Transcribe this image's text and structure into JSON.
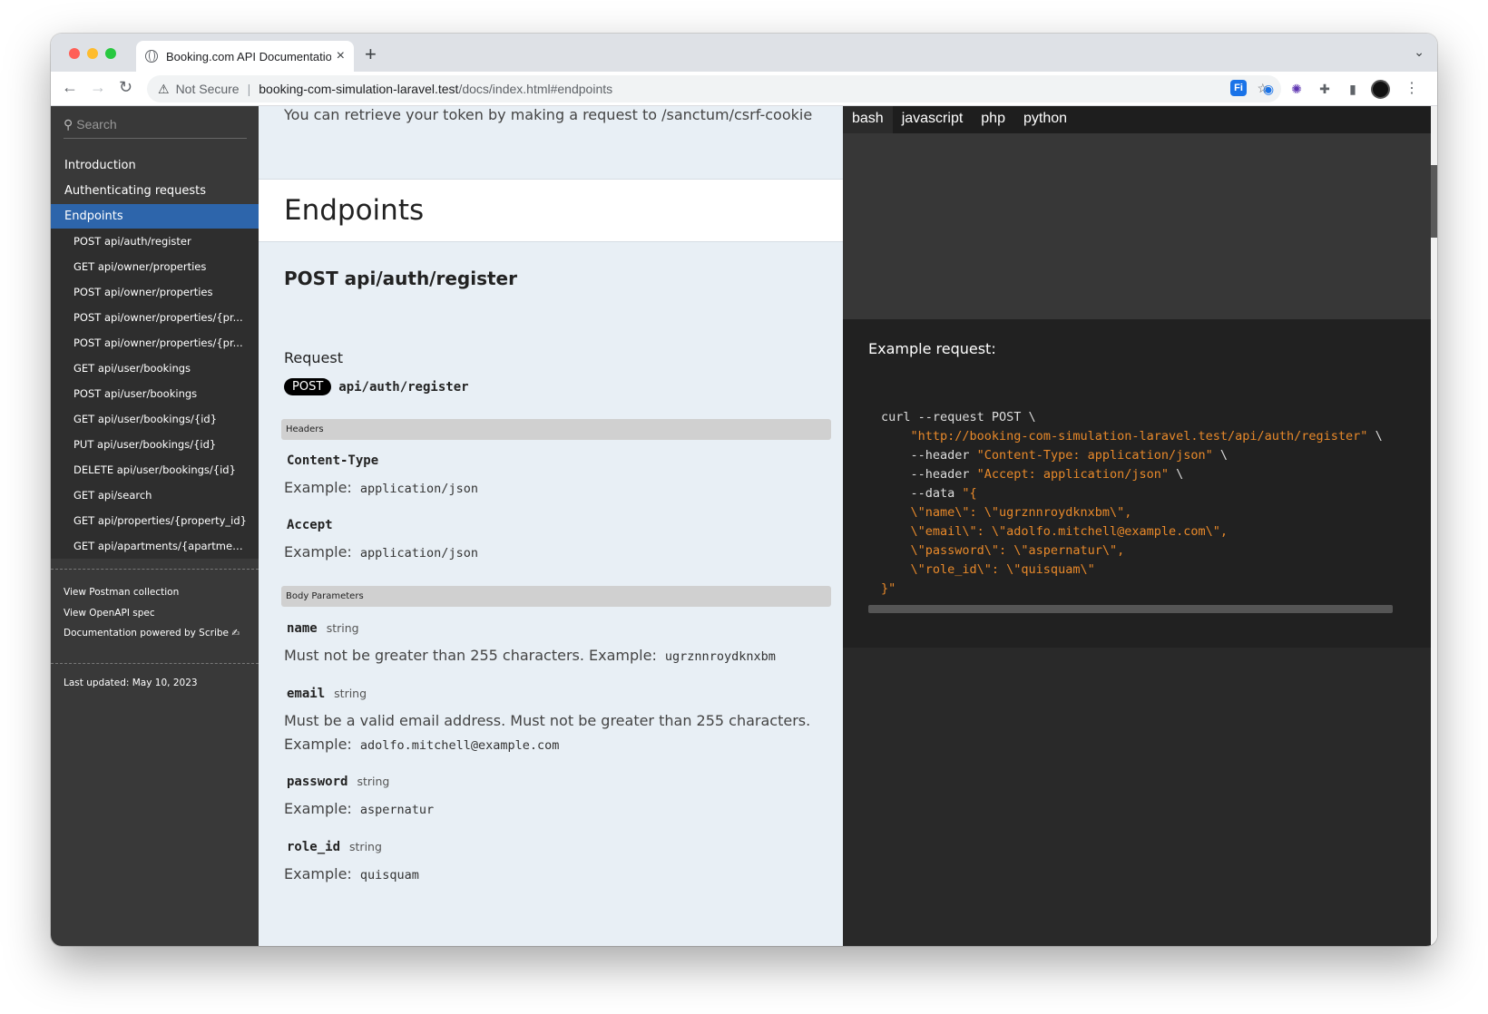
{
  "browser": {
    "tab_title": "Booking.com API Documentatio",
    "not_secure": "Not Secure",
    "url_host": "booking-com-simulation-laravel.test",
    "url_path": "/docs/index.html#endpoints",
    "extensions": [
      "share-icon",
      "bookmark-star-icon",
      "fi-extension-icon",
      "grammarly-icon",
      "sparkle-extension-icon",
      "puzzle-icon",
      "side-panel-icon",
      "profile-avatar",
      "kebab-menu-icon"
    ]
  },
  "sidebar": {
    "search_placeholder": "Search",
    "top_items": [
      {
        "label": "Introduction"
      },
      {
        "label": "Authenticating requests"
      },
      {
        "label": "Endpoints"
      }
    ],
    "sub_items": [
      {
        "label": "POST api/auth/register"
      },
      {
        "label": "GET api/owner/properties"
      },
      {
        "label": "POST api/owner/properties"
      },
      {
        "label": "POST api/owner/properties/{pr..."
      },
      {
        "label": "POST api/owner/properties/{pr..."
      },
      {
        "label": "GET api/user/bookings"
      },
      {
        "label": "POST api/user/bookings"
      },
      {
        "label": "GET api/user/bookings/{id}"
      },
      {
        "label": "PUT api/user/bookings/{id}"
      },
      {
        "label": "DELETE api/user/bookings/{id}"
      },
      {
        "label": "GET api/search"
      },
      {
        "label": "GET api/properties/{property_id}"
      },
      {
        "label": "GET api/apartments/{apartment..."
      }
    ],
    "links": {
      "postman": "View Postman collection",
      "openapi": "View OpenAPI spec",
      "powered": "Documentation powered by Scribe ✍"
    },
    "last_updated": "Last updated: May 10, 2023"
  },
  "content": {
    "token_text": "You can retrieve your token by making a request to /sanctum/csrf-cookie",
    "section_heading": "Endpoints",
    "route_heading": "POST api/auth/register",
    "request_label": "Request",
    "method": "POST",
    "path": "api/auth/register",
    "headers_label": "Headers",
    "body_label": "Body Parameters",
    "example_prefix": "Example:",
    "headers": [
      {
        "name": "Content-Type",
        "example": "application/json"
      },
      {
        "name": "Accept",
        "example": "application/json"
      }
    ],
    "params": [
      {
        "name": "name",
        "type": "string",
        "desc": "Must not be greater than 255 characters. Example:",
        "example": "ugrznnroydknxbm"
      },
      {
        "name": "email",
        "type": "string",
        "desc": "Must be a valid email address. Must not be greater than 255 characters.",
        "example_line": "Example:",
        "example": "adolfo.mitchell@example.com"
      },
      {
        "name": "password",
        "type": "string",
        "example_line": "Example:",
        "example": "aspernatur"
      },
      {
        "name": "role_id",
        "type": "string",
        "example_line": "Example:",
        "example": "quisquam"
      }
    ]
  },
  "code_panel": {
    "tabs": [
      "bash",
      "javascript",
      "php",
      "python"
    ],
    "active_tab": "bash",
    "example_label": "Example request:",
    "code": {
      "l1": "curl --request POST \\",
      "l2_str": "\"http://booking-com-simulation-laravel.test/api/auth/register\"",
      "l2_tail": " \\",
      "l3_pre": "    --header ",
      "l3_str": "\"Content-Type: application/json\"",
      "l3_tail": " \\",
      "l4_pre": "    --header ",
      "l4_str": "\"Accept: application/json\"",
      "l4_tail": " \\",
      "l5_pre": "    --data ",
      "l5_str": "\"{",
      "l6": "    \\\"name\\\": \\\"ugrznnroydknxbm\\\",",
      "l7": "    \\\"email\\\": \\\"adolfo.mitchell@example.com\\\",",
      "l8": "    \\\"password\\\": \\\"aspernatur\\\",",
      "l9": "    \\\"role_id\\\": \\\"quisquam\\\"",
      "l10": "}\""
    },
    "colors": {
      "string": "#e8892a",
      "text": "#dddddd",
      "background": "#212121"
    }
  }
}
